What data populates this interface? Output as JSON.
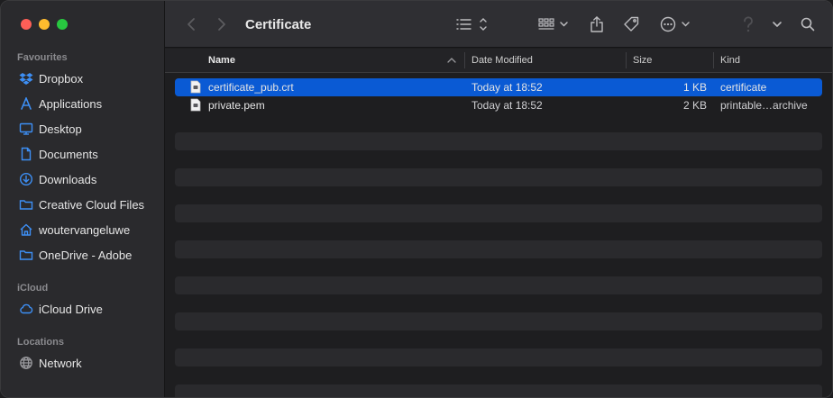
{
  "window": {
    "title": "Certificate"
  },
  "colors": {
    "close": "#fe5f57",
    "minimize": "#febc2e",
    "zoom": "#28c840",
    "accent": "#0a5ad4",
    "sidebar_icon": "#3d8ff5"
  },
  "sidebar": {
    "favourites_title": "Favourites",
    "favourites": [
      {
        "label": "Dropbox",
        "icon": "dropbox-icon"
      },
      {
        "label": "Applications",
        "icon": "applications-icon"
      },
      {
        "label": "Desktop",
        "icon": "desktop-icon"
      },
      {
        "label": "Documents",
        "icon": "document-icon"
      },
      {
        "label": "Downloads",
        "icon": "download-icon"
      },
      {
        "label": "Creative Cloud Files",
        "icon": "folder-icon"
      },
      {
        "label": "woutervangeluwe",
        "icon": "home-icon"
      },
      {
        "label": "OneDrive - Adobe",
        "icon": "folder-icon"
      }
    ],
    "icloud_title": "iCloud",
    "icloud": [
      {
        "label": "iCloud Drive",
        "icon": "cloud-icon"
      }
    ],
    "locations_title": "Locations",
    "locations": [
      {
        "label": "Network",
        "icon": "globe-icon"
      }
    ]
  },
  "columns": {
    "name": "Name",
    "date": "Date Modified",
    "size": "Size",
    "kind": "Kind"
  },
  "files": [
    {
      "name": "certificate_pub.crt",
      "date": "Today at 18:52",
      "size": "1 KB",
      "kind": "certificate",
      "selected": true
    },
    {
      "name": "private.pem",
      "date": "Today at 18:52",
      "size": "2 KB",
      "kind": "printable…archive",
      "selected": false
    }
  ]
}
